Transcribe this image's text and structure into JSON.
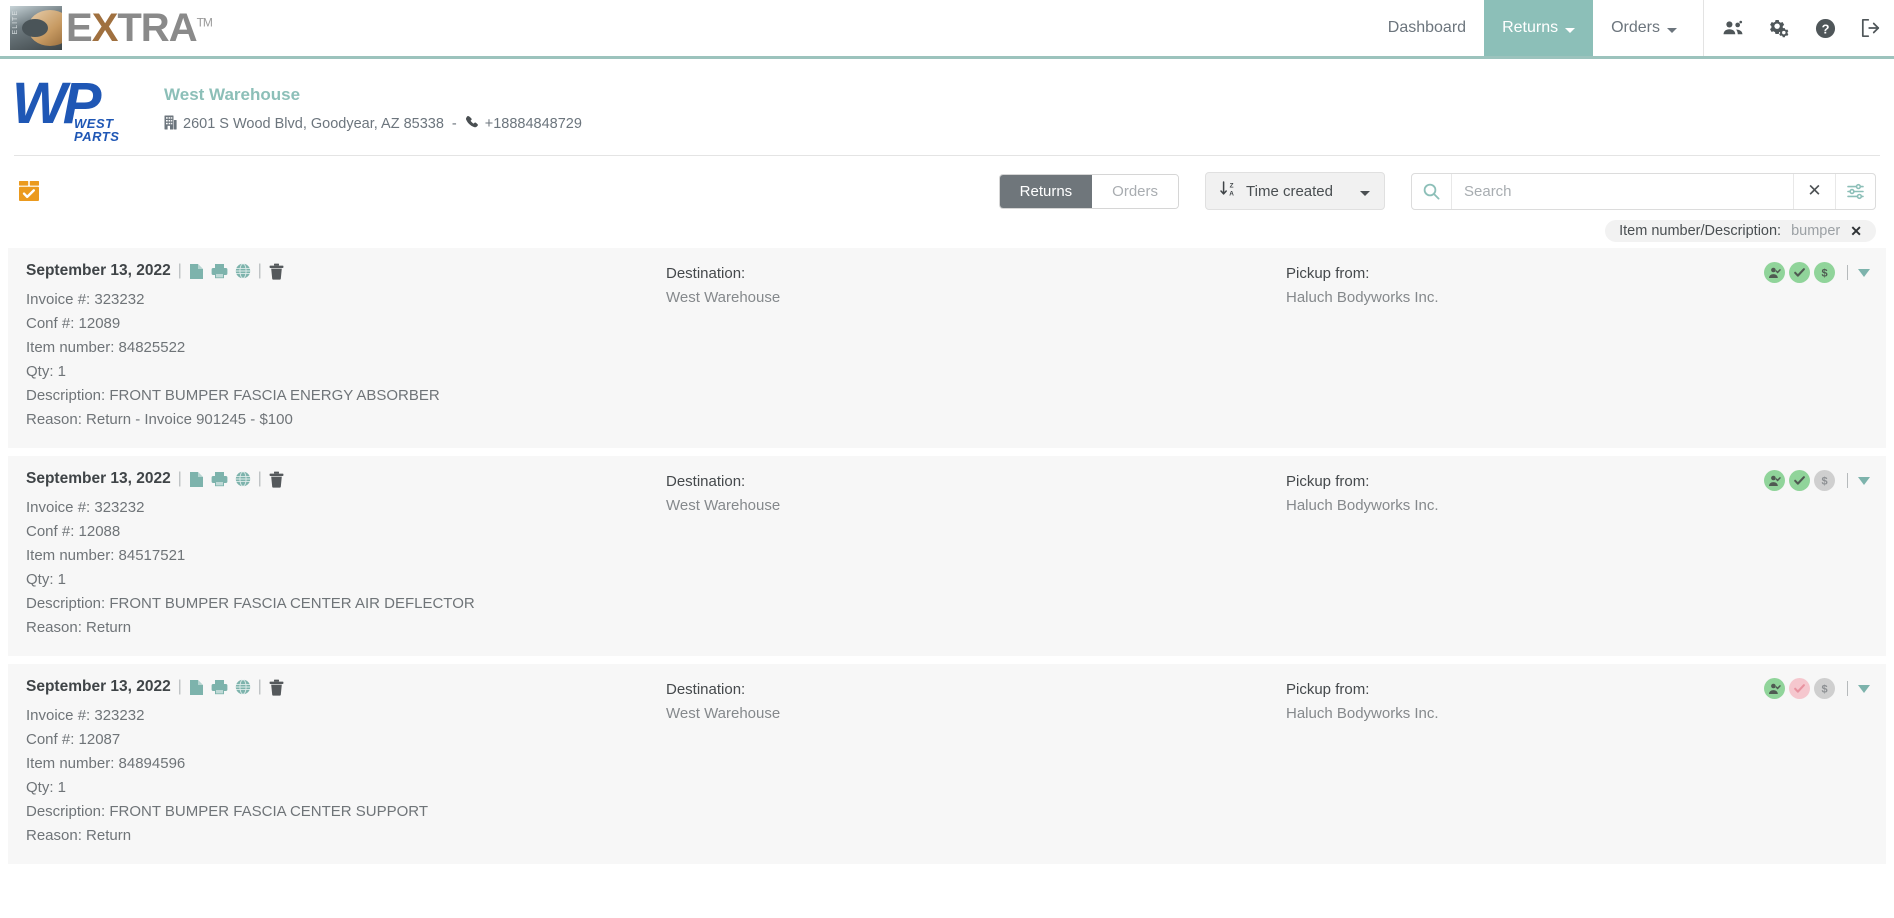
{
  "navbar": {
    "logo_text": "EXTRA",
    "logo_tm": "TM",
    "logo_badge": "ELITE",
    "links": [
      {
        "label": "Dashboard",
        "active": false,
        "caret": false
      },
      {
        "label": "Returns",
        "active": true,
        "caret": true
      },
      {
        "label": "Orders",
        "active": false,
        "caret": true
      }
    ],
    "icons": [
      {
        "name": "users-icon"
      },
      {
        "name": "gears-icon"
      },
      {
        "name": "help-icon"
      },
      {
        "name": "logout-icon"
      }
    ],
    "accent_color": "#8cbfb8"
  },
  "warehouse": {
    "logo_main": "WP",
    "logo_sub_line1": "WEST",
    "logo_sub_line2": "PARTS",
    "name": "West Warehouse",
    "address": "2601 S Wood Blvd, Goodyear, AZ 85338",
    "separator": "-",
    "phone": "+18884848729"
  },
  "toolbar": {
    "box_icon": "package-check-icon",
    "segments": [
      {
        "label": "Returns",
        "active": true
      },
      {
        "label": "Orders",
        "active": false
      }
    ],
    "sort_label": "Time created",
    "search": {
      "placeholder": "Search",
      "value": ""
    },
    "clear_label": "✕"
  },
  "filter_chip": {
    "label": "Item number/Description:",
    "value": "bumper",
    "close": "✕"
  },
  "columns": {
    "destination_label": "Destination:",
    "pickup_label": "Pickup from:"
  },
  "cards": [
    {
      "date": "September 13, 2022",
      "invoice": "Invoice #: 323232",
      "conf": "Conf #: 12089",
      "item_number": "Item number: 84825522",
      "qty": "Qty: 1",
      "description": "Description: FRONT BUMPER FASCIA ENERGY ABSORBER",
      "reason": "Reason: Return - Invoice 901245 - $100",
      "destination": "West Warehouse",
      "pickup": "Haluch Bodyworks Inc.",
      "badges": [
        {
          "icon": "user-check-icon",
          "state": "green"
        },
        {
          "icon": "check-icon",
          "state": "green"
        },
        {
          "icon": "dollar-icon",
          "state": "green"
        }
      ]
    },
    {
      "date": "September 13, 2022",
      "invoice": "Invoice #: 323232",
      "conf": "Conf #: 12088",
      "item_number": "Item number: 84517521",
      "qty": "Qty: 1",
      "description": "Description: FRONT BUMPER FASCIA CENTER AIR DEFLECTOR",
      "reason": "Reason: Return",
      "destination": "West Warehouse",
      "pickup": "Haluch Bodyworks Inc.",
      "badges": [
        {
          "icon": "user-check-icon",
          "state": "green"
        },
        {
          "icon": "check-icon",
          "state": "green"
        },
        {
          "icon": "dollar-icon",
          "state": "gray"
        }
      ]
    },
    {
      "date": "September 13, 2022",
      "invoice": "Invoice #: 323232",
      "conf": "Conf #: 12087",
      "item_number": "Item number: 84894596",
      "qty": "Qty: 1",
      "description": "Description: FRONT BUMPER FASCIA CENTER SUPPORT",
      "reason": "Reason: Return",
      "destination": "West Warehouse",
      "pickup": "Haluch Bodyworks Inc.",
      "badges": [
        {
          "icon": "user-check-icon",
          "state": "green"
        },
        {
          "icon": "check-icon",
          "state": "pink"
        },
        {
          "icon": "dollar-icon",
          "state": "gray"
        }
      ]
    }
  ]
}
